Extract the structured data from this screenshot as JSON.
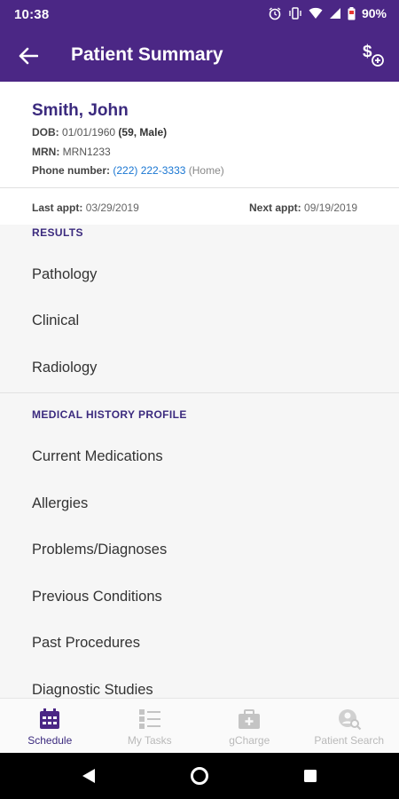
{
  "status_bar": {
    "time": "10:38",
    "battery_pct": "90%"
  },
  "app_bar": {
    "title": "Patient Summary",
    "back_icon": "arrow-back-icon",
    "charge_icon": "dollar-add-icon"
  },
  "patient": {
    "name": "Smith,  John",
    "dob_label": "DOB:",
    "dob_value": "01/01/1960",
    "dob_extra": "(59, Male)",
    "mrn_label": "MRN:",
    "mrn_value": "MRN1233",
    "phone_label": "Phone number:",
    "phone_value": "(222) 222-3333",
    "phone_type": "(Home)"
  },
  "appointments": {
    "last_label": "Last appt:",
    "last_value": "03/29/2019",
    "next_label": "Next appt:",
    "next_value": "09/19/2019"
  },
  "sections": [
    {
      "header": "RESULTS",
      "items": [
        "Pathology",
        "Clinical",
        "Radiology"
      ]
    },
    {
      "header": "MEDICAL HISTORY PROFILE",
      "items": [
        "Current Medications",
        "Allergies",
        "Problems/Diagnoses",
        "Previous Conditions",
        "Past Procedures",
        "Diagnostic Studies"
      ]
    }
  ],
  "bottom_nav": [
    {
      "label": "Schedule",
      "icon": "calendar-icon",
      "active": true
    },
    {
      "label": "My Tasks",
      "icon": "checklist-icon",
      "active": false
    },
    {
      "label": "gCharge",
      "icon": "briefcase-plus-icon",
      "active": false
    },
    {
      "label": "Patient Search",
      "icon": "person-search-icon",
      "active": false
    }
  ],
  "colors": {
    "brand": "#4b2785",
    "accent_text": "#3b2a7e",
    "link": "#1976d2",
    "inactive_nav": "#b9b9b9"
  }
}
